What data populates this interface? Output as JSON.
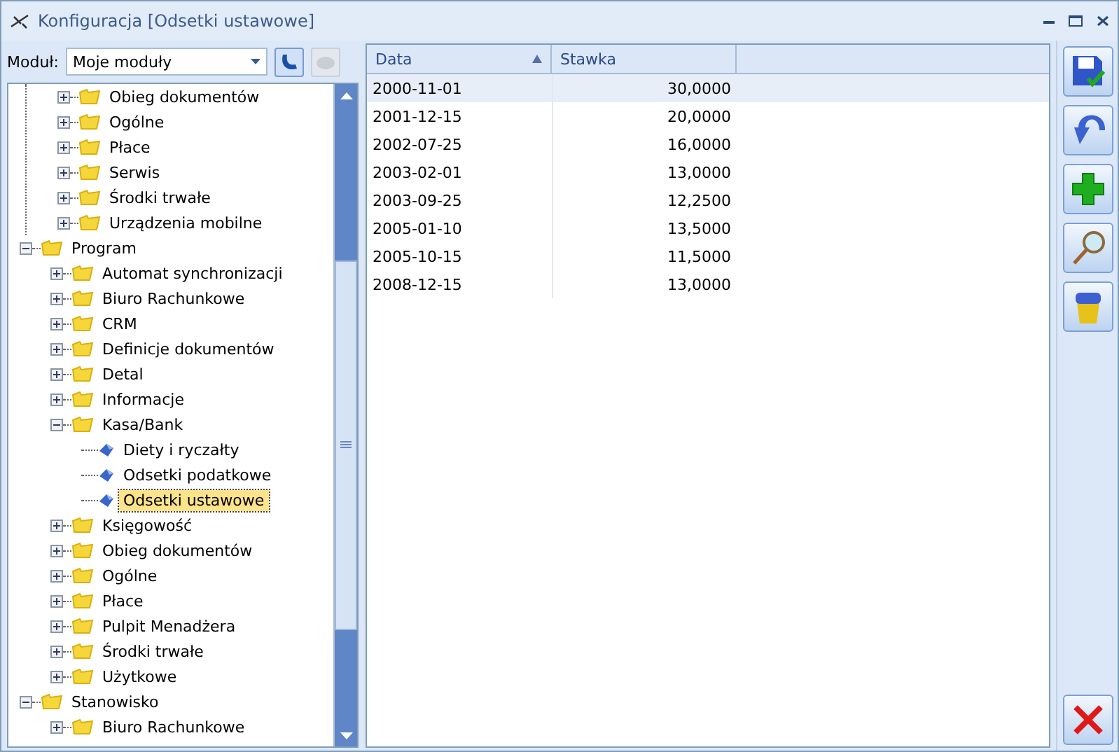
{
  "window": {
    "title": "Konfiguracja [Odsetki ustawowe]"
  },
  "module": {
    "label": "Moduł:",
    "value": "Moje moduły",
    "buttons": [
      {
        "kind": "refresh",
        "disabled": false
      },
      {
        "kind": "blank",
        "disabled": true
      }
    ]
  },
  "tree": {
    "continued_items": [
      {
        "label": "Obieg dokumentów",
        "kind": "folder",
        "expanded": false,
        "selected": false
      },
      {
        "label": "Ogólne",
        "kind": "folder",
        "expanded": false,
        "selected": false
      },
      {
        "label": "Płace",
        "kind": "folder",
        "expanded": false,
        "selected": false
      },
      {
        "label": "Serwis",
        "kind": "folder",
        "expanded": false,
        "selected": false
      },
      {
        "label": "Środki trwałe",
        "kind": "folder",
        "expanded": false,
        "selected": false
      },
      {
        "label": "Urządzenia mobilne",
        "kind": "folder",
        "expanded": false,
        "selected": false
      }
    ],
    "items": [
      {
        "label": "Program",
        "kind": "folder",
        "expanded": true,
        "selected": false,
        "children": [
          {
            "label": "Automat synchronizacji",
            "kind": "folder",
            "expanded": false,
            "selected": false
          },
          {
            "label": "Biuro Rachunkowe",
            "kind": "folder",
            "expanded": false,
            "selected": false
          },
          {
            "label": "CRM",
            "kind": "folder",
            "expanded": false,
            "selected": false
          },
          {
            "label": "Definicje dokumentów",
            "kind": "folder",
            "expanded": false,
            "selected": false
          },
          {
            "label": "Detal",
            "kind": "folder",
            "expanded": false,
            "selected": false
          },
          {
            "label": "Informacje",
            "kind": "folder",
            "expanded": false,
            "selected": false
          },
          {
            "label": "Kasa/Bank",
            "kind": "folder",
            "expanded": true,
            "selected": false,
            "children": [
              {
                "label": "Diety i ryczałty",
                "kind": "leaf",
                "selected": false
              },
              {
                "label": "Odsetki podatkowe",
                "kind": "leaf",
                "selected": false
              },
              {
                "label": "Odsetki ustawowe",
                "kind": "leaf",
                "selected": true
              }
            ]
          },
          {
            "label": "Księgowość",
            "kind": "folder",
            "expanded": false,
            "selected": false
          },
          {
            "label": "Obieg dokumentów",
            "kind": "folder",
            "expanded": false,
            "selected": false
          },
          {
            "label": "Ogólne",
            "kind": "folder",
            "expanded": false,
            "selected": false
          },
          {
            "label": "Płace",
            "kind": "folder",
            "expanded": false,
            "selected": false
          },
          {
            "label": "Pulpit Menadżera",
            "kind": "folder",
            "expanded": false,
            "selected": false
          },
          {
            "label": "Środki trwałe",
            "kind": "folder",
            "expanded": false,
            "selected": false
          },
          {
            "label": "Użytkowe",
            "kind": "folder",
            "expanded": false,
            "selected": false
          }
        ]
      },
      {
        "label": "Stanowisko",
        "kind": "folder",
        "expanded": true,
        "selected": false,
        "children": [
          {
            "label": "Biuro Rachunkowe",
            "kind": "folder",
            "expanded": false,
            "selected": false
          }
        ]
      }
    ]
  },
  "table": {
    "columns": [
      {
        "label": "Data",
        "sorted": true
      },
      {
        "label": "Stawka",
        "sorted": false
      }
    ],
    "rows": [
      {
        "date": "2000-11-01",
        "rate": "30,0000",
        "selected": true
      },
      {
        "date": "2001-12-15",
        "rate": "20,0000",
        "selected": false
      },
      {
        "date": "2002-07-25",
        "rate": "16,0000",
        "selected": false
      },
      {
        "date": "2003-02-01",
        "rate": "13,0000",
        "selected": false
      },
      {
        "date": "2003-09-25",
        "rate": "12,2500",
        "selected": false
      },
      {
        "date": "2005-01-10",
        "rate": "13,5000",
        "selected": false
      },
      {
        "date": "2005-10-15",
        "rate": "11,5000",
        "selected": false
      },
      {
        "date": "2008-12-15",
        "rate": "13,0000",
        "selected": false
      }
    ]
  },
  "toolbar": [
    {
      "kind": "save"
    },
    {
      "kind": "undo"
    },
    {
      "kind": "add"
    },
    {
      "kind": "search"
    },
    {
      "kind": "delete"
    }
  ],
  "footer_button": {
    "kind": "close"
  }
}
